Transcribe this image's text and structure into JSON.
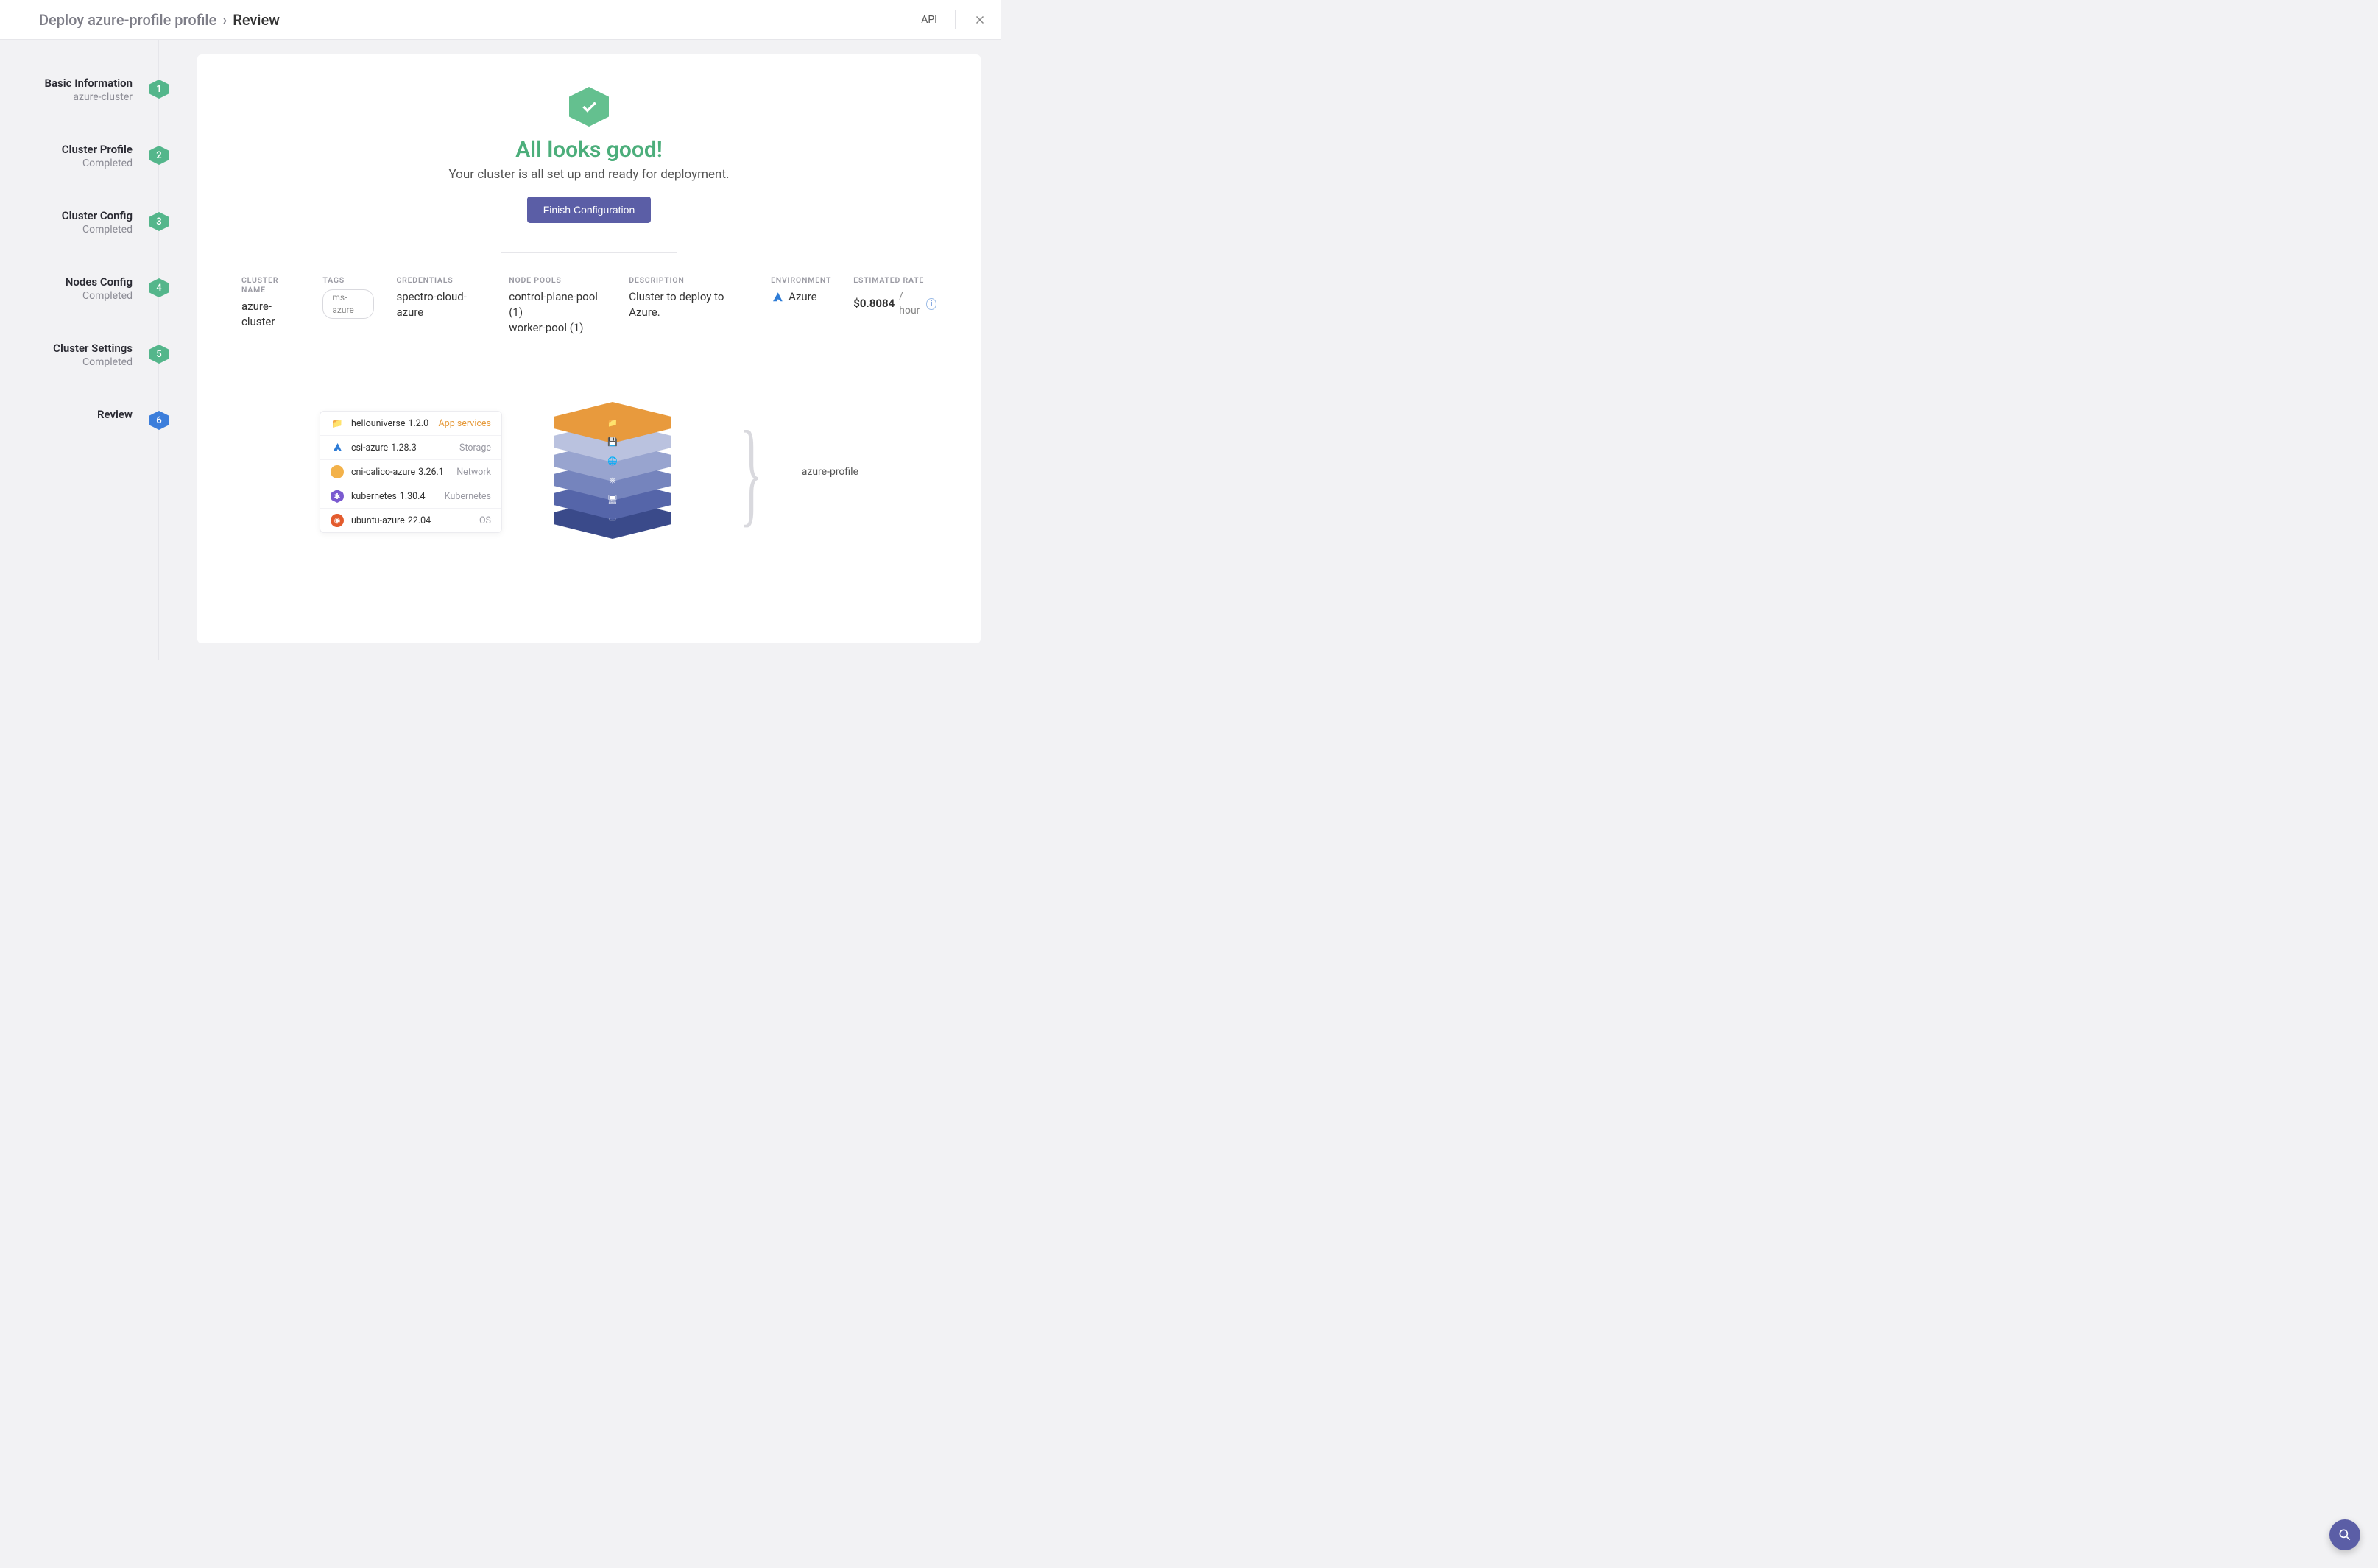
{
  "header": {
    "breadcrumb_prefix": "Deploy azure-profile profile",
    "breadcrumb_current": "Review",
    "api_label": "API"
  },
  "steps": [
    {
      "title": "Basic Information",
      "sub": "azure-cluster",
      "num": "1",
      "state": "done"
    },
    {
      "title": "Cluster Profile",
      "sub": "Completed",
      "num": "2",
      "state": "done"
    },
    {
      "title": "Cluster Config",
      "sub": "Completed",
      "num": "3",
      "state": "done"
    },
    {
      "title": "Nodes Config",
      "sub": "Completed",
      "num": "4",
      "state": "done"
    },
    {
      "title": "Cluster Settings",
      "sub": "Completed",
      "num": "5",
      "state": "done"
    },
    {
      "title": "Review",
      "sub": "",
      "num": "6",
      "state": "current"
    }
  ],
  "hero": {
    "headline": "All looks good!",
    "sub": "Your cluster is all set up and ready for deployment.",
    "button": "Finish Configuration"
  },
  "summary": {
    "cluster_name": {
      "label": "CLUSTER NAME",
      "value": "azure-cluster"
    },
    "tags": {
      "label": "TAGS",
      "value": "ms-azure"
    },
    "credentials": {
      "label": "CREDENTIALS",
      "value": "spectro-cloud-azure"
    },
    "node_pools": {
      "label": "NODE POOLS",
      "line1": "control-plane-pool (1)",
      "line2": "worker-pool (1)"
    },
    "description": {
      "label": "DESCRIPTION",
      "value": "Cluster to deploy to Azure."
    },
    "environment": {
      "label": "ENVIRONMENT",
      "value": "Azure"
    },
    "rate": {
      "label": "ESTIMATED RATE",
      "amount": "$0.8084",
      "unit": "/ hour"
    }
  },
  "profile": {
    "name": "azure-profile",
    "layers": [
      {
        "name": "hellouniverse",
        "version": "1.2.0",
        "type": "App services",
        "kind": "app",
        "color": "#e89a3d"
      },
      {
        "name": "csi-azure",
        "version": "1.28.3",
        "type": "Storage",
        "kind": "storage",
        "color": "#3a78c4"
      },
      {
        "name": "cni-calico-azure",
        "version": "3.26.1",
        "type": "Network",
        "kind": "network",
        "color": "#d98a3a"
      },
      {
        "name": "kubernetes",
        "version": "1.30.4",
        "type": "Kubernetes",
        "kind": "k8s",
        "color": "#7a5ad0"
      },
      {
        "name": "ubuntu-azure",
        "version": "22.04",
        "type": "OS",
        "kind": "os",
        "color": "#e35b2d"
      }
    ]
  }
}
